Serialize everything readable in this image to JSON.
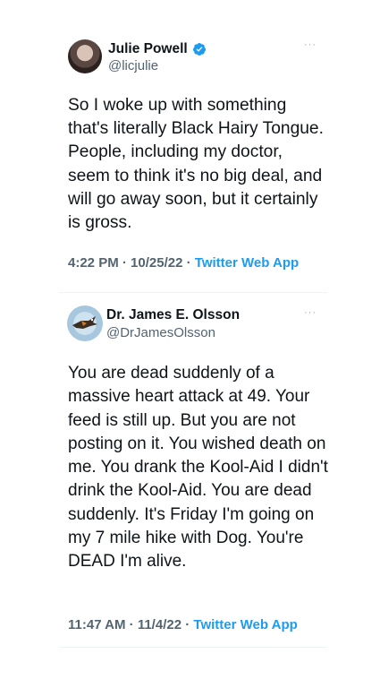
{
  "tweets": [
    {
      "author": {
        "display_name": "Julie Powell",
        "handle": "@licjulie",
        "verified": true
      },
      "text": "So I woke up with something that's literally Black Hairy Tongue. People, including my doctor, seem to think it's no big deal, and will go away soon, but it certainly is gross.",
      "time": "4:22 PM",
      "date": "10/25/22",
      "source": "Twitter Web App",
      "separator": " · "
    },
    {
      "author": {
        "display_name": "Dr. James E. Olsson",
        "handle": "@DrJamesOlsson",
        "verified": false
      },
      "text": "You are dead suddenly of a massive heart attack at 49. Your feed is still up. But you are not posting on it. You wished death on me. You drank the Kool-Aid I didn't drink the Kool-Aid. You are dead suddenly. It's Friday I'm going on my 7 mile hike with Dog. You're DEAD I'm alive.",
      "time": "11:47 AM",
      "date": "11/4/22",
      "source": "Twitter Web App",
      "separator": " · "
    }
  ],
  "more_glyph": "···",
  "colors": {
    "accent": "#1d9bf0",
    "secondary_text": "#536471",
    "primary_text": "#0f1419"
  }
}
